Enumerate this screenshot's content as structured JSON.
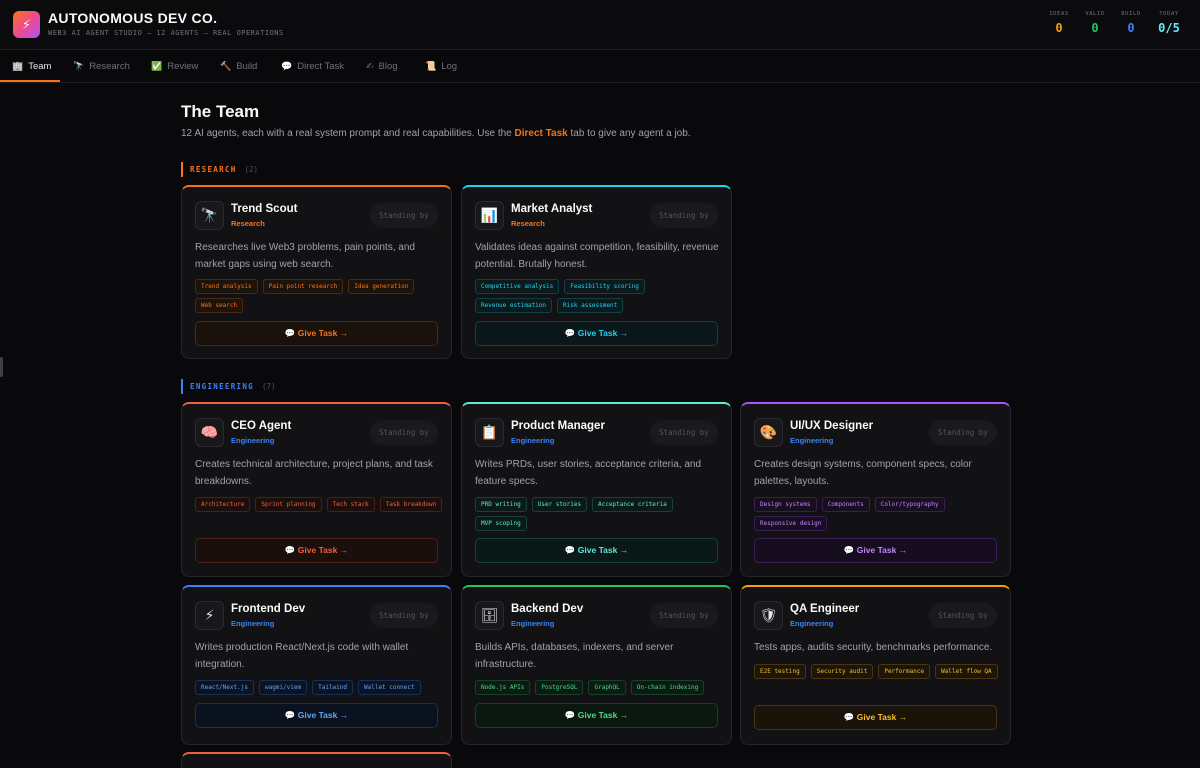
{
  "header": {
    "logo_icon": "lightning-bolt-icon",
    "title": "AUTONOMOUS DEV CO.",
    "subtitle": "WEB3 AI AGENT STUDIO — 12 AGENTS — REAL OPERATIONS",
    "stats": [
      {
        "label": "IDEAS",
        "value": "0",
        "color": "#f59e0b"
      },
      {
        "label": "VALID",
        "value": "0",
        "color": "#22c55e"
      },
      {
        "label": "BUILD",
        "value": "0",
        "color": "#3b82f6"
      },
      {
        "label": "TODAY",
        "value": "0/5",
        "color": "#67e8f9"
      }
    ]
  },
  "nav": {
    "tabs": [
      {
        "icon": "🏢",
        "label": "Team",
        "active": true
      },
      {
        "icon": "🔭",
        "label": "Research"
      },
      {
        "icon": "✅",
        "label": "Review"
      },
      {
        "icon": "🔨",
        "label": "Build"
      },
      {
        "icon": "💬",
        "label": "Direct Task"
      },
      {
        "icon": "✍",
        "label": "Blog"
      },
      {
        "icon": "📜",
        "label": "Log"
      }
    ]
  },
  "main": {
    "title": "The Team",
    "desc_before": "12 AI agents, each with a real system prompt and real capabilities. Use the ",
    "desc_highlight": "Direct Task",
    "desc_after": " tab to give any agent a job."
  },
  "sections": [
    {
      "label": "RESEARCH",
      "count": "(2)",
      "color": "#f97316"
    },
    {
      "label": "ENGINEERING",
      "count": "(7)",
      "color": "#3b82f6"
    }
  ],
  "status_label": "Standing by",
  "give_task_label": "💬 Give Task →",
  "agents": [
    {
      "name": "Trend Scout",
      "category": "Research",
      "icon": "🔭",
      "color": "#f97316",
      "desc": "Researches live Web3 problems, pain points, and market gaps using web search.",
      "skills": [
        "Trend analysis",
        "Pain point research",
        "Idea generation",
        "Web search"
      ]
    },
    {
      "name": "Market Analyst",
      "category": "Research",
      "icon": "📊",
      "color": "#22d3ee",
      "desc": "Validates ideas against competition, feasibility, revenue potential. Brutally honest.",
      "skills": [
        "Competitive analysis",
        "Feasibility scoring",
        "Revenue estimation",
        "Risk assessment"
      ]
    },
    {
      "name": "CEO Agent",
      "category": "Engineering",
      "icon": "🧠",
      "color": "#f25f3a",
      "desc": "Creates technical architecture, project plans, and task breakdowns.",
      "skills": [
        "Architecture",
        "Sprint planning",
        "Tech stack",
        "Task breakdown"
      ]
    },
    {
      "name": "Product Manager",
      "category": "Engineering",
      "icon": "📋",
      "color": "#5eead4",
      "desc": "Writes PRDs, user stories, acceptance criteria, and feature specs.",
      "skills": [
        "PRD writing",
        "User stories",
        "Acceptance criteria",
        "MVP scoping"
      ]
    },
    {
      "name": "UI/UX Designer",
      "category": "Engineering",
      "icon": "🎨",
      "color": "#a855f7",
      "desc": "Creates design systems, component specs, color palettes, layouts.",
      "skills": [
        "Design systems",
        "Components",
        "Color/typography",
        "Responsive design"
      ]
    },
    {
      "name": "Frontend Dev",
      "category": "Engineering",
      "icon": "⚡",
      "color": "#3b82f6",
      "desc": "Writes production React/Next.js code with wallet integration.",
      "skills": [
        "React/Next.js",
        "wagmi/viem",
        "Tailwind",
        "Wallet connect"
      ]
    },
    {
      "name": "Backend Dev",
      "category": "Engineering",
      "icon": "🗄",
      "color": "#22c55e",
      "desc": "Builds APIs, databases, indexers, and server infrastructure.",
      "skills": [
        "Node.js APIs",
        "PostgreSQL",
        "GraphQL",
        "On-chain indexing"
      ]
    },
    {
      "name": "QA Engineer",
      "category": "Engineering",
      "icon": "🛡",
      "color": "#f59e0b",
      "desc": "Tests apps, audits security, benchmarks performance.",
      "skills": [
        "E2E testing",
        "Security audit",
        "Performance",
        "Wallet flow QA"
      ]
    }
  ]
}
